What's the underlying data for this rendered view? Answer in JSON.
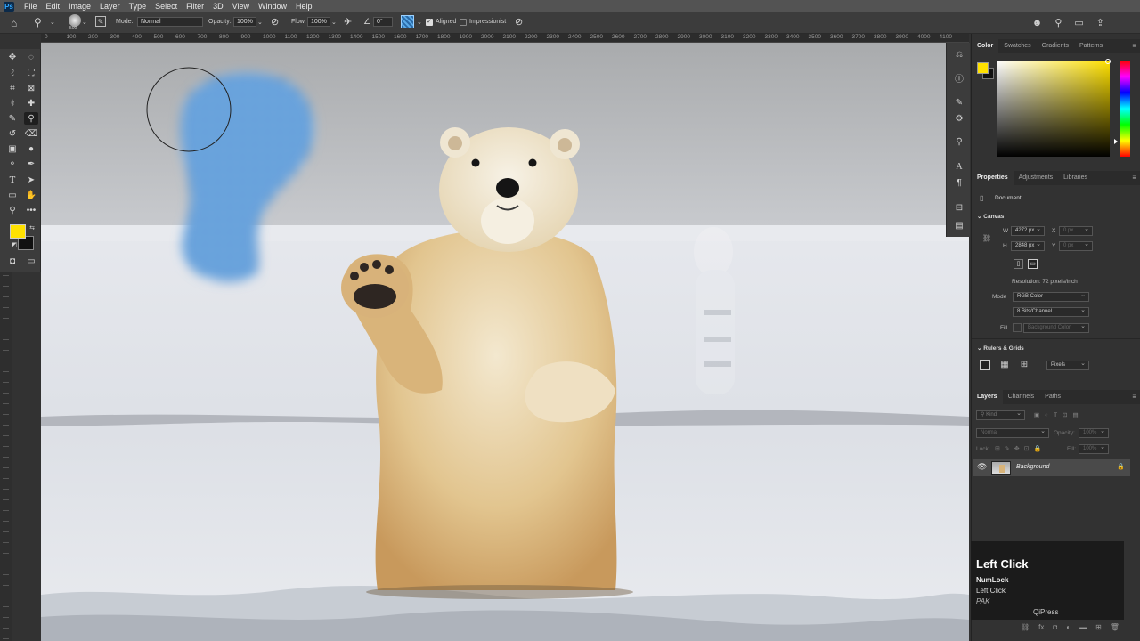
{
  "app": {
    "logo": "Ps"
  },
  "menu": [
    "File",
    "Edit",
    "Image",
    "Layer",
    "Type",
    "Select",
    "Filter",
    "3D",
    "View",
    "Window",
    "Help"
  ],
  "options": {
    "brush_size": "500",
    "mode_label": "Mode:",
    "mode_value": "Normal",
    "opacity_label": "Opacity:",
    "opacity_value": "100%",
    "flow_label": "Flow:",
    "flow_value": "100%",
    "angle_value": "0°",
    "aligned_label": "Aligned",
    "impressionist_label": "Impressionist"
  },
  "ruler_labels": [
    "0",
    "100",
    "200",
    "300",
    "400",
    "500",
    "600",
    "700",
    "800",
    "900",
    "1000",
    "1100",
    "1200",
    "1300",
    "1400",
    "1500",
    "1600",
    "1700",
    "1800",
    "1900",
    "2000",
    "2100",
    "2200",
    "2300",
    "2400",
    "2500",
    "2600",
    "2700",
    "2800",
    "2900",
    "3000",
    "3100",
    "3200",
    "3300",
    "3400",
    "3500",
    "3600",
    "3700",
    "3800",
    "3900",
    "4000",
    "4100"
  ],
  "color_panel": {
    "tabs": [
      "Color",
      "Swatches",
      "Gradients",
      "Patterns"
    ],
    "foreground": "#ffe100",
    "background": "#111111"
  },
  "properties_panel": {
    "tabs": [
      "Properties",
      "Adjustments",
      "Libraries"
    ],
    "doc_label": "Document",
    "canvas_title": "Canvas",
    "w_label": "W",
    "w_value": "4272 px",
    "x_label": "X",
    "x_placeholder": "0 px",
    "h_label": "H",
    "h_value": "2848 px",
    "y_label": "Y",
    "y_placeholder": "0 px",
    "resolution": "Resolution: 72 pixels/inch",
    "mode_label": "Mode",
    "mode_value": "RGB Color",
    "depth_value": "8 Bits/Channel",
    "fill_label": "Fill",
    "fill_value": "Background Color",
    "rulers_title": "Rulers & Grids",
    "units_value": "Pixels"
  },
  "layers_panel": {
    "tabs": [
      "Layers",
      "Channels",
      "Paths"
    ],
    "kind_placeholder": "Kind",
    "blend_mode": "Normal",
    "opacity_label": "Opacity:",
    "opacity_value": "100%",
    "lock_label": "Lock:",
    "fill_label": "Fill:",
    "fill_value": "100%",
    "layer_name": "Background"
  },
  "key_overlay": {
    "title": "Left Click",
    "line1": "NumLock",
    "line2": "Left Click",
    "line3": "PAK",
    "brand": "QiPress"
  },
  "swatches": {
    "accent": "#31a8ff"
  }
}
